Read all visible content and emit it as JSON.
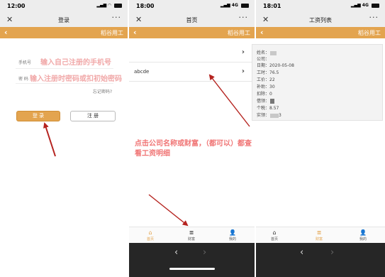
{
  "screen1": {
    "status_time": "12:00",
    "wx_title": "登录",
    "app_brand": "稻谷用工",
    "phone_label": "手机号",
    "phone_hint": "输入自己注册的手机号",
    "pwd_label": "密 码",
    "pwd_hint": "输入注册时密码或扣初始密码",
    "forgot": "忘记密码?",
    "login_btn": "登 录",
    "register_btn": "注 册"
  },
  "screen2": {
    "status_time": "18:00",
    "status_net": "4G",
    "wx_title": "首页",
    "app_brand": "稻谷用工",
    "list": [
      {
        "name": ""
      },
      {
        "name": "abcde"
      }
    ],
    "annotation": "点击公司名称或财富，（都可以）都查看工资明细",
    "tabs": [
      {
        "icon": "⌂",
        "label": "首页"
      },
      {
        "icon": "≣",
        "label": "财富"
      },
      {
        "icon": "👤",
        "label": "我的"
      }
    ]
  },
  "screen3": {
    "status_time": "18:01",
    "status_net": "4G",
    "wx_title": "工资列表",
    "app_brand": "稻谷用工",
    "card": {
      "name_label": "姓名：",
      "company_label": "公司：",
      "date_label": "日期：",
      "date": "2020-05-08",
      "hours_label": "工时：",
      "hours": "76.5",
      "wage_label": "工价：",
      "wage": "22",
      "subsidy_label": "补助：",
      "subsidy": "30",
      "deduct_label": "扣除：",
      "deduct": "0",
      "borrow_label": "借领：",
      "tax_label": "个税：",
      "tax": "8.57",
      "actual_label": "实领：",
      "actual": "3"
    },
    "tabs": [
      {
        "icon": "⌂",
        "label": "首页"
      },
      {
        "icon": "≣",
        "label": "财富"
      },
      {
        "icon": "👤",
        "label": "我的"
      }
    ]
  },
  "colors": {
    "accent": "#e3a44f",
    "annotation": "#f07575",
    "arrow": "#b5231f"
  }
}
